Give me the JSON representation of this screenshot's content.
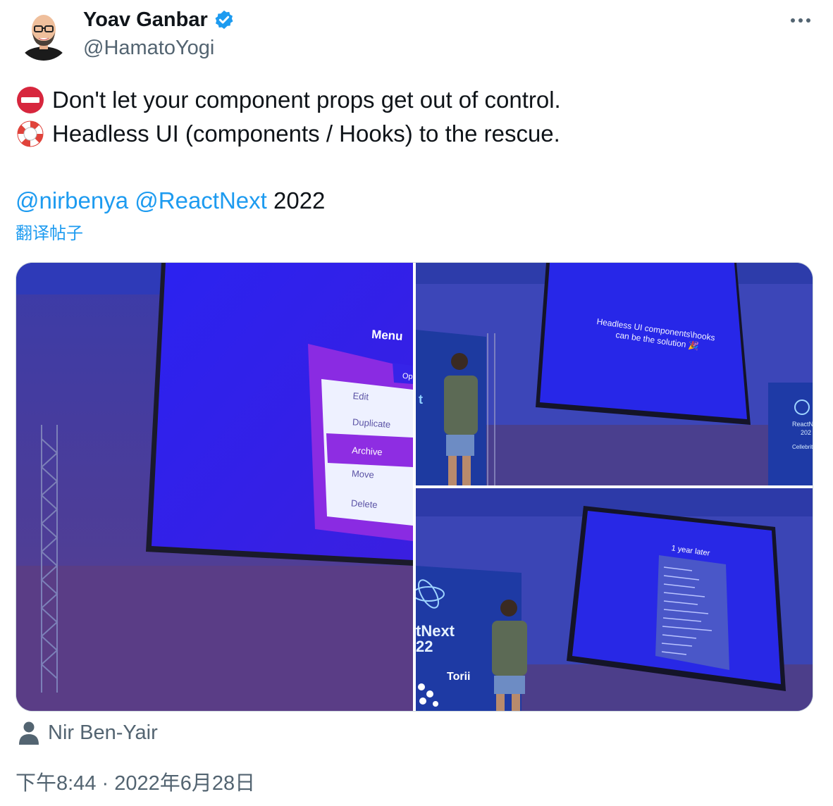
{
  "author": {
    "display_name": "Yoav Ganbar",
    "handle": "@HamatoYogi",
    "verified_icon": "verified-badge-icon",
    "avatar_icon": "avatar-illustration"
  },
  "more_icon": "more-options-icon",
  "tweet": {
    "line1": {
      "emoji_icon": "no-entry-icon",
      "text": "Don't let your component props get out of control."
    },
    "line2": {
      "emoji_icon": "lifebuoy-icon",
      "text": "Headless UI (components / Hooks) to the rescue."
    },
    "mentions": [
      "@nirbenya",
      "@ReactNext"
    ],
    "year": "2022"
  },
  "translate_label": "翻译帖子",
  "photos": {
    "photo1": {
      "title": "Menu",
      "button": "Op",
      "items": [
        "Edit",
        "Duplicate",
        "Archive",
        "Move",
        "Delete"
      ]
    },
    "photo2": {
      "slide_line1": "Headless UI components\\hooks",
      "slide_line2": "can be the solution 🎉",
      "banner_text": "ReactN",
      "banner_year": "202",
      "sponsor": "Cellebrite"
    },
    "photo3": {
      "slide_title": "1 year later",
      "banner_text": "tNext",
      "banner_year": "22",
      "sponsor": "Torii"
    }
  },
  "tagged_user": "Nir Ben-Yair",
  "timestamp": "下午8:44 · 2022年6月28日",
  "colors": {
    "link": "#1d9bf0",
    "secondary": "#536471",
    "verified": "#1d9bf0"
  }
}
